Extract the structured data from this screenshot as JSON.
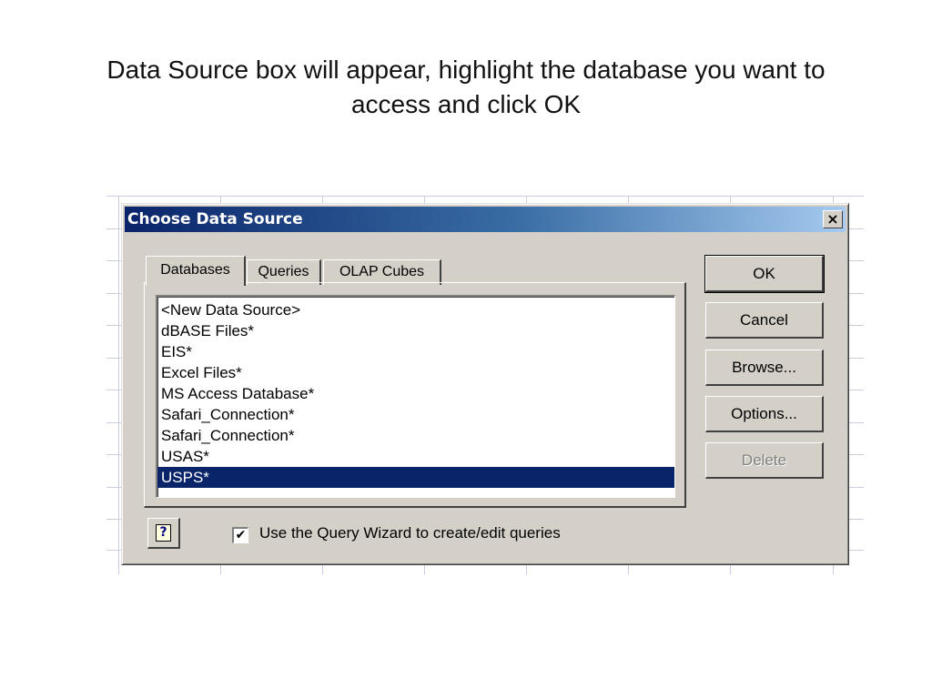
{
  "slide": {
    "title_line1": "Data Source box will appear, highlight the database you want to",
    "title_line2": "access and click OK"
  },
  "dialog": {
    "title": "Choose Data Source",
    "close_glyph": "×",
    "tabs": [
      {
        "label": "Databases",
        "active": true
      },
      {
        "label": "Queries",
        "active": false
      },
      {
        "label": "OLAP Cubes",
        "active": false
      }
    ],
    "list_items": [
      "<New Data Source>",
      "dBASE Files*",
      "EIS*",
      "Excel Files*",
      "MS Access Database*",
      "Safari_Connection*",
      "Safari_Connection*",
      "USAS*",
      "USPS*"
    ],
    "selected_item": "USPS*",
    "buttons": {
      "ok": "OK",
      "cancel": "Cancel",
      "browse": "Browse...",
      "options": "Options...",
      "delete": "Delete"
    },
    "help_glyph": "?",
    "checkbox_label": "Use the Query Wizard to create/edit queries",
    "checkbox_checked": true,
    "check_glyph": "✔"
  },
  "colors": {
    "titlebar_start": "#0a246a",
    "titlebar_end": "#a6caf0",
    "selection": "#0a246a",
    "dialog_face": "#d4d0c8"
  }
}
